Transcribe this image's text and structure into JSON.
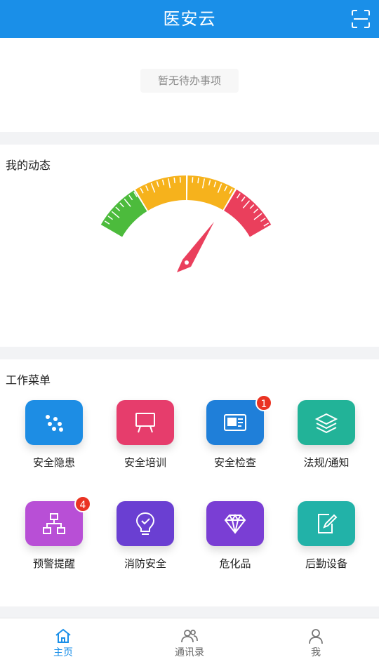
{
  "header": {
    "title": "医安云",
    "scan_icon": "scan-icon"
  },
  "todo": {
    "message": "暂无待办事项"
  },
  "dynamic": {
    "title": "我的动态"
  },
  "menu": {
    "title": "工作菜单",
    "items": [
      {
        "label": "安全隐患",
        "icon": "dots-icon",
        "color": "#1d8de4",
        "badge": ""
      },
      {
        "label": "安全培训",
        "icon": "presentation-board-icon",
        "color": "#e63d6c",
        "badge": ""
      },
      {
        "label": "安全检查",
        "icon": "id-card-icon",
        "color": "#1f7fd9",
        "badge": "1"
      },
      {
        "label": "法规/通知",
        "icon": "layers-icon",
        "color": "#22b398",
        "badge": ""
      },
      {
        "label": "预警提醒",
        "icon": "hierarchy-icon",
        "color": "#b84fd6",
        "badge": "4"
      },
      {
        "label": "消防安全",
        "icon": "lightbulb-icon",
        "color": "#6a3fd2",
        "badge": ""
      },
      {
        "label": "危化品",
        "icon": "diamond-icon",
        "color": "#7a3ed4",
        "badge": ""
      },
      {
        "label": "后勤设备",
        "icon": "edit-document-icon",
        "color": "#22b2a8",
        "badge": ""
      }
    ]
  },
  "tabbar": {
    "tabs": [
      {
        "label": "主页",
        "icon": "home-icon",
        "active": true
      },
      {
        "label": "通讯录",
        "icon": "contacts-icon",
        "active": false
      },
      {
        "label": "我",
        "icon": "user-icon",
        "active": false
      }
    ]
  },
  "colors": {
    "primary": "#1a8fe8",
    "gauge_green": "#4cbb3c",
    "gauge_yellow": "#f6b21c",
    "gauge_red": "#ea3f5c"
  }
}
